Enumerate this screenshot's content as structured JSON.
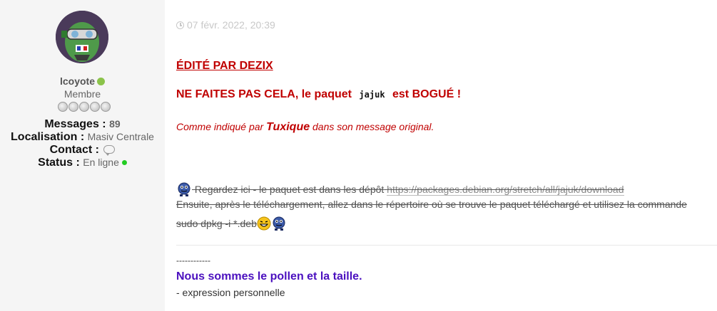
{
  "user": {
    "name": "lcoyote",
    "rank": "Membre",
    "rank_stars": 5,
    "stats": {
      "messages_label": "Messages :",
      "messages_value": "89",
      "location_label": "Localisation :",
      "location_value": "Masiv Centrale",
      "contact_label": "Contact :",
      "status_label": "Status :",
      "status_value": "En ligne"
    },
    "colors": {
      "online": "#8bc34a",
      "status": "#22cc22"
    }
  },
  "post": {
    "date": "07 févr. 2022, 20:39",
    "edited_by": "ÉDITÉ PAR DEZIX",
    "warning_before": "NE FAITES PAS CELA, le paquet",
    "warning_code": "jajuk",
    "warning_after": "est BOGUÉ !",
    "note_before": "Comme indiqué par",
    "note_author": "Tuxique",
    "note_after": "dans son message original.",
    "line1_text": " Regardez ici - le paquet est dans les dépôt",
    "line1_link": "https://packages.debian.org/stretch/all/jajuk/download",
    "line2_text": "Ensuite, après le téléchargement, allez dans le répertoire où se trouve le paquet téléchargé et utilisez la commande",
    "line3_text": "sudo dpkg -i *.deb",
    "colors": {
      "accent_red": "#c00000",
      "signature": "#4b10bf"
    }
  },
  "signature": {
    "dashes": "------------",
    "title": "Nous sommes le pollen et la taille.",
    "subtitle": "- expression personnelle"
  }
}
